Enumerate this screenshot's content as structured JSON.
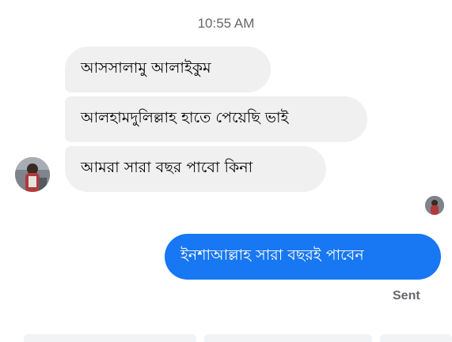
{
  "conversation": {
    "timestamp": "10:55 AM",
    "messages": [
      {
        "direction": "incoming",
        "text": "আসসালামু আলাইকুম"
      },
      {
        "direction": "incoming",
        "text": "আলহামদুলিল্লাহ হাতে পেয়েছি ভাই"
      },
      {
        "direction": "incoming",
        "text": "আমরা সারা বছর পাবো কিনা"
      },
      {
        "direction": "outgoing",
        "text": "ইনশাআল্লাহ সারা বছরই পাবেন"
      }
    ],
    "status": "Sent"
  },
  "colors": {
    "outgoing_bubble": "#1877f2",
    "incoming_bubble": "#f0f0f0",
    "muted_text": "#65676b"
  },
  "icons": {
    "sender_avatar": "avatar",
    "seen_indicator": "seen-avatar-icon"
  }
}
